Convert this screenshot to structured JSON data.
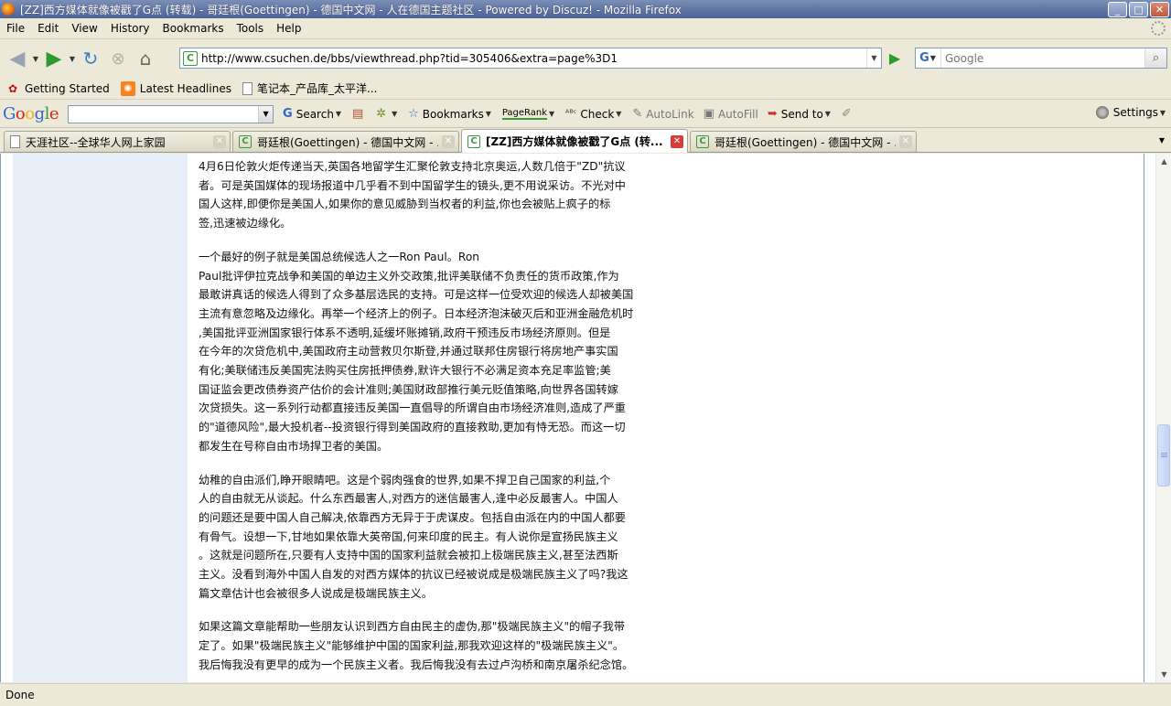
{
  "window": {
    "title": "[ZZ]西方媒体就像被戳了G点 (转载) - 哥廷根(Goettingen) - 德国中文网 - 人在德国主题社区 - Powered by Discuz! - Mozilla Firefox",
    "buttons": {
      "minimize": "_",
      "maximize": "□",
      "close": "✕"
    }
  },
  "menu": [
    "File",
    "Edit",
    "View",
    "History",
    "Bookmarks",
    "Tools",
    "Help"
  ],
  "nav": {
    "url": "http://www.csuchen.de/bbs/viewthread.php?tid=305406&extra=page%3D1",
    "search_placeholder": "Google",
    "search_engine_letter": "G"
  },
  "bookmarks": [
    "Getting Started",
    "Latest Headlines",
    "笔记本_产品库_太平洋..."
  ],
  "google_toolbar": {
    "logo": [
      "G",
      "o",
      "o",
      "g",
      "l",
      "e"
    ],
    "search": "Search",
    "bookmarks": "Bookmarks",
    "pagerank": "PageRank",
    "check": "Check",
    "autolink": "AutoLink",
    "autofill": "AutoFill",
    "sendto": "Send to",
    "settings": "Settings"
  },
  "tabs": [
    {
      "label": "天涯社区--全球华人网上家园",
      "icon": "page",
      "active": false
    },
    {
      "label": "哥廷根(Goettingen) - 德国中文网 - ...",
      "icon": "c",
      "active": false
    },
    {
      "label": "[ZZ]西方媒体就像被戳了G点 (转...",
      "icon": "c",
      "active": true
    },
    {
      "label": "哥廷根(Goettingen) - 德国中文网 - ...",
      "icon": "c",
      "active": false
    }
  ],
  "article": {
    "paragraphs": [
      [
        "4月6日伦敦火炬传递当天,英国各地留学生汇聚伦敦支持北京奥运,人数几倍于\"ZD\"抗议",
        "者。可是英国媒体的现场报道中几乎看不到中国留学生的镜头,更不用说采访。不光对中",
        "国人这样,即便你是美国人,如果你的意见威胁到当权者的利益,你也会被贴上疯子的标",
        "签,迅速被边缘化。"
      ],
      [
        "一个最好的例子就是美国总统候选人之一Ron Paul。Ron",
        "Paul批评伊拉克战争和美国的单边主义外交政策,批评美联储不负责任的货币政策,作为",
        "最敢讲真话的候选人得到了众多基层选民的支持。可是这样一位受欢迎的候选人却被美国",
        "主流有意忽略及边缘化。再举一个经济上的例子。日本经济泡沫破灭后和亚洲金融危机时",
        ",美国批评亚洲国家银行体系不透明,延缓坏账摊销,政府干预违反市场经济原则。但是",
        "在今年的次贷危机中,美国政府主动营救贝尔斯登,并通过联邦住房银行将房地产事实国",
        "有化;美联储违反美国宪法购买住房抵押债券,默许大银行不必满足资本充足率监管;美",
        "国证监会更改债券资产估价的会计准则;美国财政部推行美元贬值策略,向世界各国转嫁",
        "次贷损失。这一系列行动都直接违反美国一直倡导的所谓自由市场经济准则,造成了严重",
        "的\"道德风险\",最大投机者--投资银行得到美国政府的直接救助,更加有恃无恐。而这一切",
        "都发生在号称自由市场捍卫者的美国。"
      ],
      [
        "幼稚的自由派们,睁开眼睛吧。这是个弱肉强食的世界,如果不捍卫自己国家的利益,个",
        "人的自由就无从谈起。什么东西最害人,对西方的迷信最害人,逢中必反最害人。中国人",
        "的问题还是要中国人自己解决,依靠西方无异于于虎谋皮。包括自由派在内的中国人都要",
        "有骨气。设想一下,甘地如果依靠大英帝国,何来印度的民主。有人说你是宣扬民族主义",
        "。这就是问题所在,只要有人支持中国的国家利益就会被扣上极端民族主义,甚至法西斯",
        "主义。没看到海外中国人自发的对西方媒体的抗议已经被说成是极端民族主义了吗?我这",
        "篇文章估计也会被很多人说成是极端民族主义。"
      ],
      [
        "如果这篇文章能帮助一些朋友认识到西方自由民主的虚伪,那\"极端民族主义\"的帽子我带",
        "定了。如果\"极端民族主义\"能够维护中国的国家利益,那我欢迎这样的\"极端民族主义\"。",
        "我后悔我没有更早的成为一个民族主义者。我后悔我没有去过卢沟桥和南京屠杀纪念馆。"
      ]
    ]
  },
  "status": "Done"
}
